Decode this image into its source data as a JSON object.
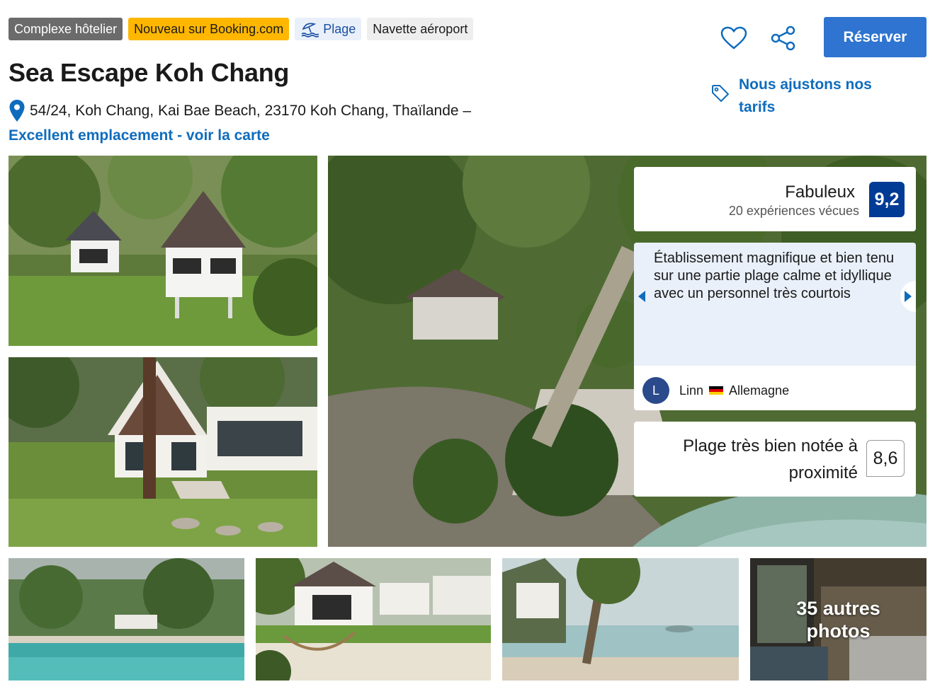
{
  "badges": {
    "type": "Complexe hôtelier",
    "new": "Nouveau sur Booking.com",
    "beach": "Plage",
    "shuttle": "Navette aéroport"
  },
  "hotel": {
    "name": "Sea Escape Koh Chang",
    "address": "54/24, Koh Chang, Kai Bae Beach, 23170 Koh Chang, Thaïlande –",
    "map_link": "Excellent emplacement - voir la carte"
  },
  "actions": {
    "reserve_label": "Réserver",
    "price_match": "Nous ajustons nos tarifs"
  },
  "rating": {
    "label": "Fabuleux",
    "count_text": "20 expériences vécues",
    "score": "9,2"
  },
  "review": {
    "text": "Établissement magnifique et bien tenu sur une partie plage calme et idyllique avec un personnel très courtois",
    "initial": "L",
    "name": "Linn",
    "country": "Allemagne"
  },
  "beach_rating": {
    "text": "Plage très bien notée à proximité",
    "score": "8,6"
  },
  "gallery": {
    "more_photos": "35 autres photos"
  },
  "colors": {
    "brand_blue": "#003b95",
    "link_blue": "#0f6cbd",
    "button_blue": "#2e74d0",
    "badge_yellow": "#ffb700"
  }
}
